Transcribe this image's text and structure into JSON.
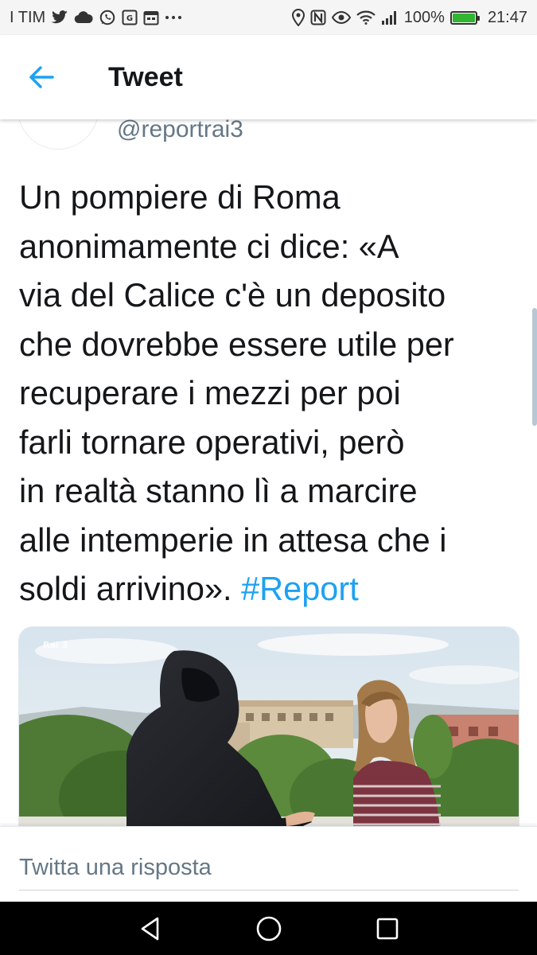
{
  "status_bar": {
    "carrier": "I TIM",
    "battery_percent": "100%",
    "battery_level": 1.0,
    "time": "21:47",
    "icons_left": [
      "twitter-icon",
      "cloud-icon",
      "whatsapp-icon",
      "gallery-icon",
      "calendar-icon",
      "more-icon"
    ],
    "icons_right": [
      "location-icon",
      "nfc-icon",
      "eye-icon",
      "wifi-icon",
      "signal-icon",
      "battery-icon"
    ]
  },
  "header": {
    "title": "Tweet",
    "back_icon": "arrow-left-icon"
  },
  "tweet": {
    "handle": "@reportrai3",
    "text_body": "Un pompiere di Roma\nanonimamente ci dice: «A\nvia del Calice c'è un deposito\nche dovrebbe essere utile per\nrecuperare i mezzi per poi\nfarli tornare operativi, però\nin realtà stanno lì a marcire\nalle intemperie in attesa che i\nsoldi arrivino». ",
    "hashtag": "#Report"
  },
  "reply": {
    "placeholder": "Twitta una risposta"
  },
  "nav": {
    "back_icon": "triangle-back-icon",
    "home_icon": "circle-home-icon",
    "recents_icon": "square-recents-icon"
  },
  "colors": {
    "accent": "#1da1f2",
    "text": "#14171a",
    "secondary_text": "#657786",
    "battery": "#2fb530"
  }
}
